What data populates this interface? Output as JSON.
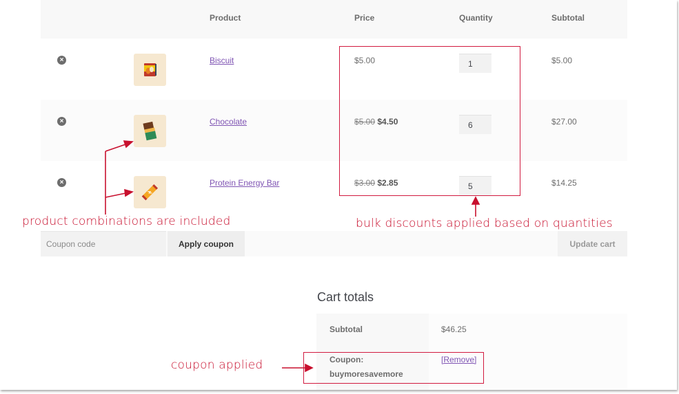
{
  "table": {
    "headers": {
      "remove": "",
      "thumbnail": "",
      "product": "Product",
      "price": "Price",
      "quantity": "Quantity",
      "subtotal": "Subtotal"
    },
    "rows": [
      {
        "remove_icon": "remove-circle-icon",
        "remove_glyph": "×",
        "thumbnail_icon": "biscuit-icon",
        "product": "Biscuit",
        "price_original": "",
        "price": "$5.00",
        "quantity": "1",
        "subtotal": "$5.00"
      },
      {
        "remove_icon": "remove-circle-icon",
        "remove_glyph": "×",
        "thumbnail_icon": "chocolate-icon",
        "product": "Chocolate",
        "price_original": "$5.00",
        "price": "$4.50",
        "quantity": "6",
        "subtotal": "$27.00"
      },
      {
        "remove_icon": "remove-circle-icon",
        "remove_glyph": "×",
        "thumbnail_icon": "energy-bar-icon",
        "product": "Protein Energy Bar",
        "price_original": "$3.00",
        "price": "$2.85",
        "quantity": "5",
        "subtotal": "$14.25"
      }
    ]
  },
  "actions": {
    "coupon_placeholder": "Coupon code",
    "coupon_value": "",
    "apply_label": "Apply coupon",
    "update_label": "Update cart"
  },
  "totals": {
    "title": "Cart totals",
    "subtotal_label": "Subtotal",
    "subtotal_value": "$46.25",
    "coupon_label": "Coupon:",
    "coupon_code": "buymoresavemore",
    "remove_label": "[Remove]"
  },
  "annotations": {
    "product_combinations": "product combinations are included",
    "bulk_discounts": "bulk discounts applied based on quantities",
    "coupon_applied": "coupon applied",
    "color": "#c8102e"
  }
}
